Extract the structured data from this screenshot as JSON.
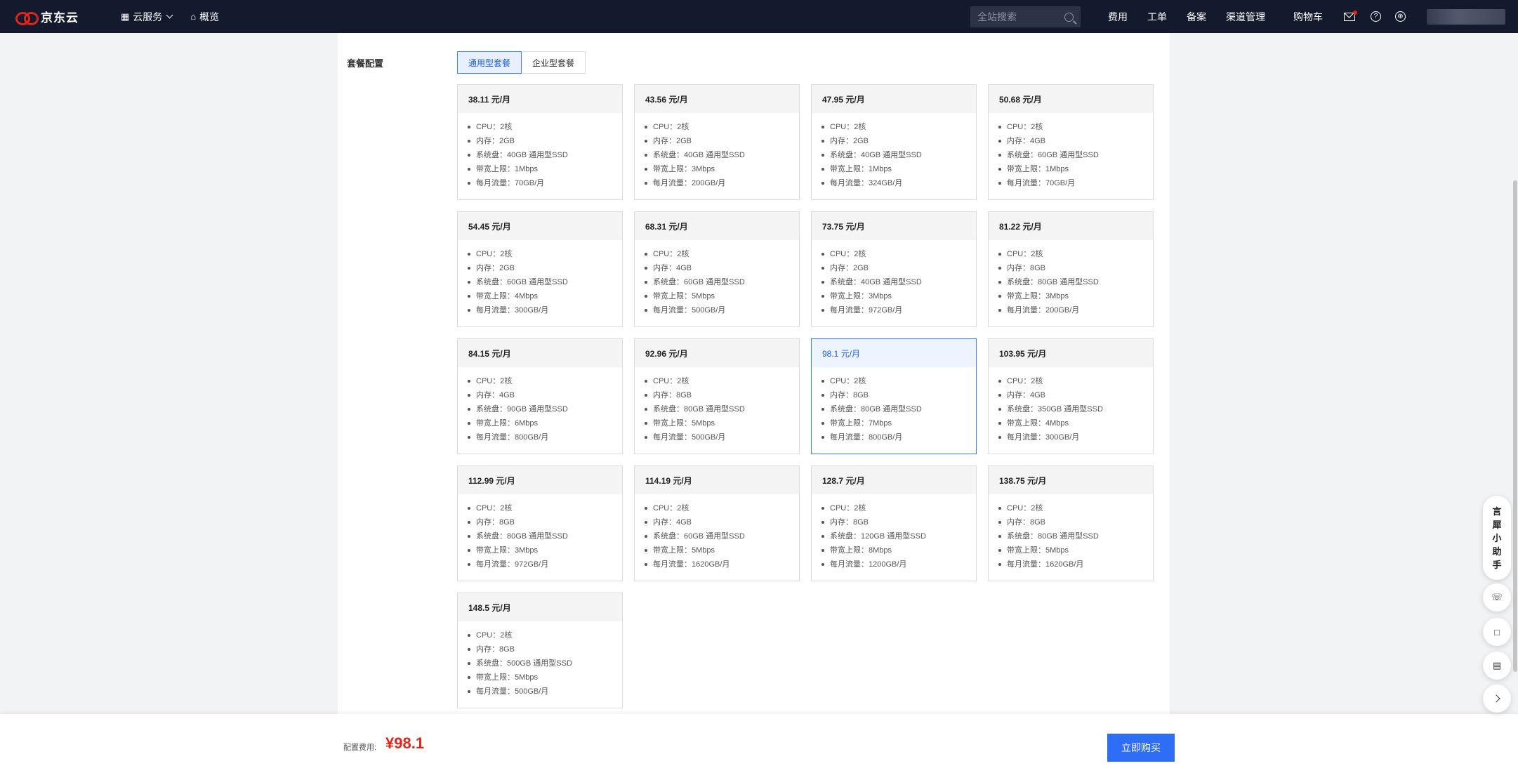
{
  "topbar": {
    "logo_text": "京东云",
    "nav": [
      {
        "icon": "grid-icon",
        "label": "云服务"
      },
      {
        "icon": "home-icon",
        "label": "概览"
      }
    ],
    "search_placeholder": "全站搜索",
    "links": [
      "费用",
      "工单",
      "备案",
      "渠道管理",
      "购物车"
    ],
    "colors": {
      "bg": "#131a2e",
      "brand_red": "#e1251b"
    }
  },
  "config": {
    "section_label": "套餐配置",
    "tabs": [
      "通用型套餐",
      "企业型套餐"
    ],
    "active_tab": 0,
    "packages": [
      {
        "price": "38.11 元/月",
        "specs": [
          "CPU：2核",
          "内存：2GB",
          "系统盘：40GB 通用型SSD",
          "带宽上限：1Mbps",
          "每月流量：70GB/月"
        ]
      },
      {
        "price": "43.56 元/月",
        "specs": [
          "CPU：2核",
          "内存：2GB",
          "系统盘：40GB 通用型SSD",
          "带宽上限：3Mbps",
          "每月流量：200GB/月"
        ]
      },
      {
        "price": "47.95 元/月",
        "specs": [
          "CPU：2核",
          "内存：2GB",
          "系统盘：40GB 通用型SSD",
          "带宽上限：1Mbps",
          "每月流量：324GB/月"
        ]
      },
      {
        "price": "50.68 元/月",
        "specs": [
          "CPU：2核",
          "内存：4GB",
          "系统盘：60GB 通用型SSD",
          "带宽上限：1Mbps",
          "每月流量：70GB/月"
        ]
      },
      {
        "price": "54.45 元/月",
        "specs": [
          "CPU：2核",
          "内存：2GB",
          "系统盘：60GB 通用型SSD",
          "带宽上限：4Mbps",
          "每月流量：300GB/月"
        ]
      },
      {
        "price": "68.31 元/月",
        "specs": [
          "CPU：2核",
          "内存：4GB",
          "系统盘：60GB 通用型SSD",
          "带宽上限：5Mbps",
          "每月流量：500GB/月"
        ]
      },
      {
        "price": "73.75 元/月",
        "specs": [
          "CPU：2核",
          "内存：2GB",
          "系统盘：40GB 通用型SSD",
          "带宽上限：3Mbps",
          "每月流量：972GB/月"
        ]
      },
      {
        "price": "81.22 元/月",
        "specs": [
          "CPU：2核",
          "内存：8GB",
          "系统盘：80GB 通用型SSD",
          "带宽上限：3Mbps",
          "每月流量：200GB/月"
        ]
      },
      {
        "price": "84.15 元/月",
        "specs": [
          "CPU：2核",
          "内存：4GB",
          "系统盘：90GB 通用型SSD",
          "带宽上限：6Mbps",
          "每月流量：800GB/月"
        ]
      },
      {
        "price": "92.96 元/月",
        "specs": [
          "CPU：2核",
          "内存：8GB",
          "系统盘：80GB 通用型SSD",
          "带宽上限：5Mbps",
          "每月流量：500GB/月"
        ]
      },
      {
        "price": "98.1 元/月",
        "specs": [
          "CPU：2核",
          "内存：8GB",
          "系统盘：80GB 通用型SSD",
          "带宽上限：7Mbps",
          "每月流量：800GB/月"
        ]
      },
      {
        "price": "103.95 元/月",
        "specs": [
          "CPU：2核",
          "内存：4GB",
          "系统盘：350GB 通用型SSD",
          "带宽上限：4Mbps",
          "每月流量：300GB/月"
        ]
      },
      {
        "price": "112.99 元/月",
        "specs": [
          "CPU：2核",
          "内存：8GB",
          "系统盘：80GB 通用型SSD",
          "带宽上限：3Mbps",
          "每月流量：972GB/月"
        ]
      },
      {
        "price": "114.19 元/月",
        "specs": [
          "CPU：2核",
          "内存：4GB",
          "系统盘：60GB 通用型SSD",
          "带宽上限：5Mbps",
          "每月流量：1620GB/月"
        ]
      },
      {
        "price": "128.7 元/月",
        "specs": [
          "CPU：2核",
          "内存：8GB",
          "系统盘：120GB 通用型SSD",
          "带宽上限：8Mbps",
          "每月流量：1200GB/月"
        ]
      },
      {
        "price": "138.75 元/月",
        "specs": [
          "CPU：2核",
          "内存：8GB",
          "系统盘：80GB 通用型SSD",
          "带宽上限：5Mbps",
          "每月流量：1620GB/月"
        ]
      },
      {
        "price": "148.5 元/月",
        "specs": [
          "CPU：2核",
          "内存：8GB",
          "系统盘：500GB 通用型SSD",
          "带宽上限：5Mbps",
          "每月流量：500GB/月"
        ]
      }
    ],
    "selected_index": 10,
    "accent_color": "#2e6ef7"
  },
  "bottom": {
    "cost_label": "配置费用:",
    "cost_value": "¥98.1",
    "buy_label": "立即购买"
  },
  "floating": {
    "assistant_label": "言犀小助手",
    "buttons": [
      "headset-icon",
      "chat-icon",
      "clipboard-icon",
      "chevron-right-icon"
    ]
  }
}
